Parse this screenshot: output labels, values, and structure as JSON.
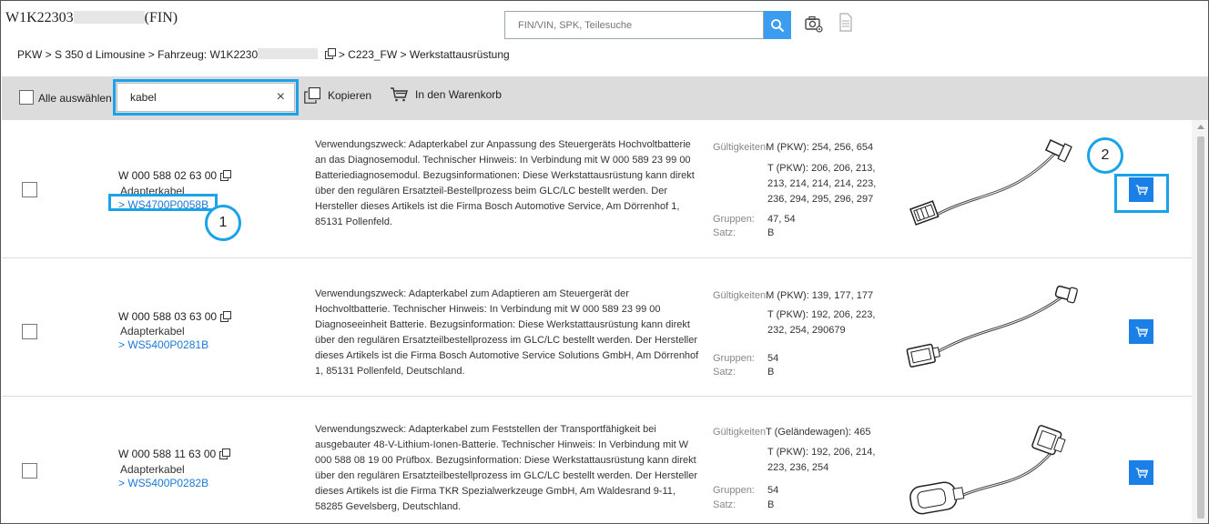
{
  "header": {
    "vin_prefix": "W1K22303",
    "vin_suffix": "(FIN)",
    "search_placeholder": "FIN/VIN, SPK, Teilesuche"
  },
  "breadcrumb": {
    "part1": "PKW > S 350 d Limousine > Fahrzeug: W1K2230",
    "part2": "> C223_FW  > Werkstattausrüstung"
  },
  "toolbar": {
    "select_all": "Alle auswählen",
    "filter_value": "kabel",
    "copy_label": "Kopieren",
    "cart_label": "In den Warenkorb"
  },
  "labels": {
    "validity": "Gültigkeiten",
    "groups": "Gruppen:",
    "set": "Satz:"
  },
  "rows": [
    {
      "part_number": "W 000 588 02 63 00",
      "part_name": "Adapterkabel",
      "ws_link": "> WS4700P0058B",
      "description": "Verwendungszweck: Adapterkabel zur Anpassung des Steuergeräts Hochvoltbatterie an das Diagnosemodul. Technischer Hinweis: In Verbindung mit W  000  589  23  99  00 Batteriediagnosemodul. Bezugsinformationen: Diese Werkstattausrüstung kann direkt über den regulären Ersatzteil-Bestellprozess beim GLC/LC bestellt werden. Der Hersteller dieses Artikels ist die Firma Bosch Automotive Service, Am Dörrenhof 1, 85131 Pollenfeld.",
      "validity_first": "M (PKW): 254, 256, 654",
      "validity_rest": "T (PKW): 206, 206, 213, 213, 214, 214, 214, 223, 236, 294, 295, 296, 297",
      "groups": "47, 54",
      "set": "B"
    },
    {
      "part_number": "W 000 588 03 63 00",
      "part_name": "Adapterkabel",
      "ws_link": "> WS5400P0281B",
      "description": "Verwendungszweck: Adapterkabel zum Adaptieren am Steuergerät der Hochvoltbatterie. Technischer Hinweis: In Verbindung mit W  000  589  23  99  00 Diagnoseeinheit Batterie. Bezugsinformation: Diese Werkstattausrüstung kann direkt über den regulären Ersatzteilbestellprozess im GLC/LC bestellt werden. Der Hersteller dieses Artikels ist die Firma Bosch Automotive Service Solutions GmbH, Am Dörrenhof 1, 85131 Pollenfeld, Deutschland.",
      "validity_first": "M (PKW): 139, 177, 177",
      "validity_rest": "T (PKW): 192, 206, 223, 232, 254, 290679",
      "groups": "54",
      "set": "B"
    },
    {
      "part_number": "W 000 588 11 63 00",
      "part_name": "Adapterkabel",
      "ws_link": "> WS5400P0282B",
      "description": "Verwendungszweck: Adapterkabel zum Feststellen der Transportfähigkeit bei ausgebauter 48-V-Lithium-Ionen-Batterie. Technischer Hinweis: In Verbindung mit W  000  588  08  19  00 Prüfbox. Bezugsinformation: Diese Werkstattausrüstung kann direkt über den regulären Ersatzteilbestellprozess im GLC/LC bestellt werden. Der Hersteller dieses Artikels ist die Firma TKR Spezialwerkzeuge GmbH, Am Waldesrand 9-11, 58285 Gevelsberg, Deutschland.",
      "validity_first": "T (Geländewagen): 465",
      "validity_rest": "T (PKW): 192, 206, 214, 223, 236, 254",
      "groups": "54",
      "set": "B"
    }
  ],
  "annotations": {
    "badge_1": "1",
    "badge_2": "2"
  },
  "colors": {
    "accent": "#1a7fe6",
    "highlight": "#1aa3e8",
    "link": "#1b78d6",
    "toolbar_bg": "#dcdcdc"
  },
  "icons": [
    "search-icon",
    "camera-settings-icon",
    "document-icon",
    "copy-icon",
    "cart-icon",
    "close-icon"
  ]
}
